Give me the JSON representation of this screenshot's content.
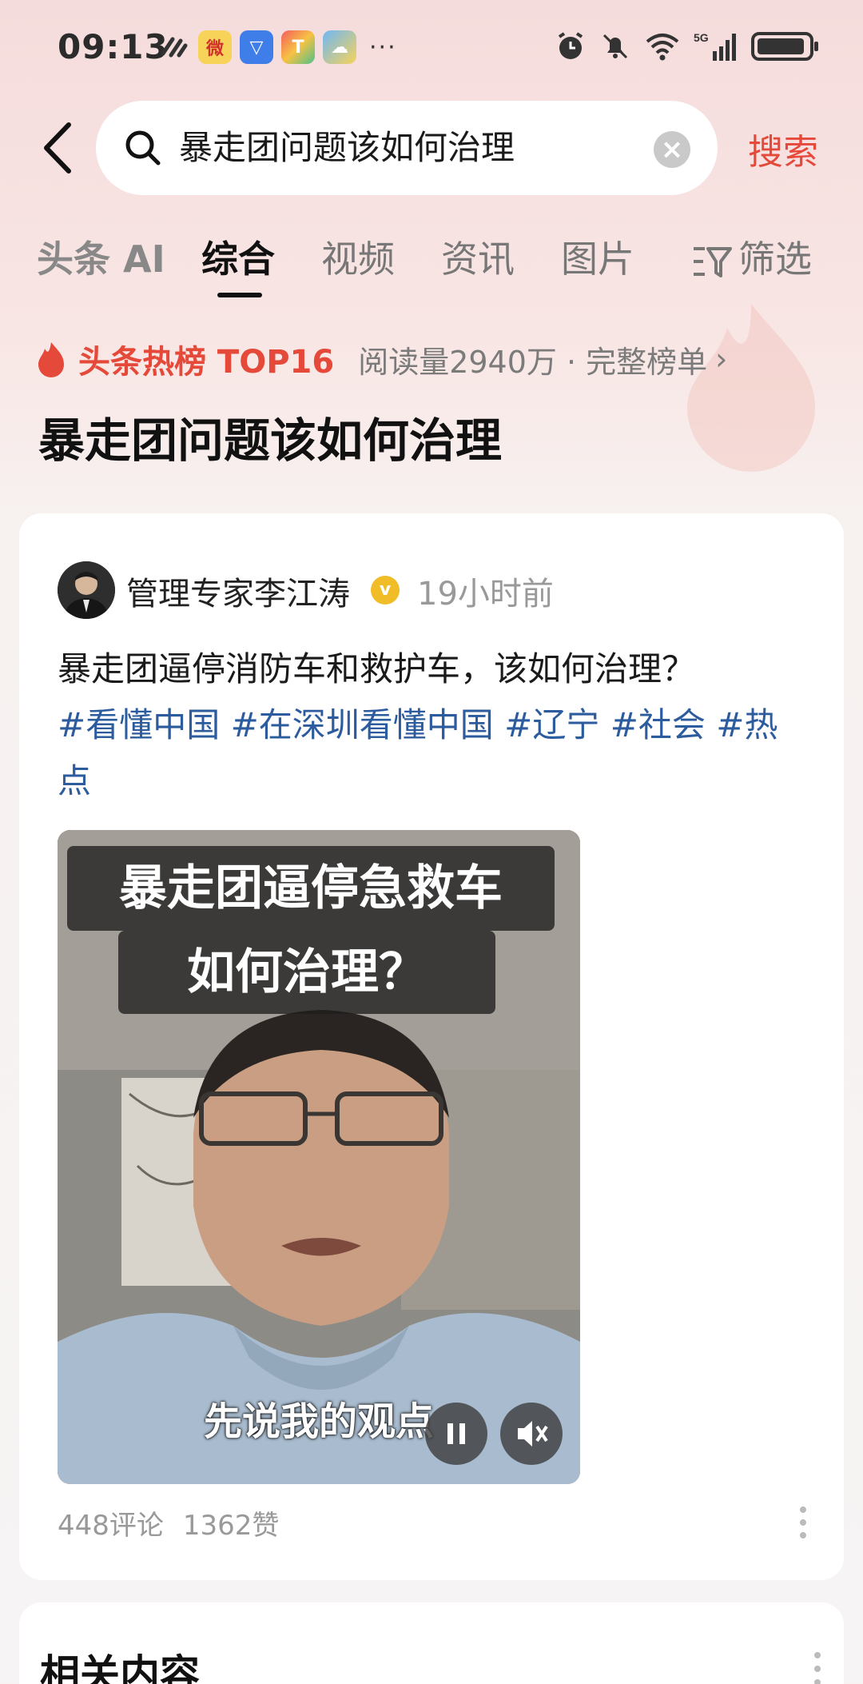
{
  "status_bar": {
    "time": "09:13",
    "more": "···",
    "network": "5G"
  },
  "search": {
    "query": "暴走团问题该如何治理",
    "submit_label": "搜索"
  },
  "tabs": [
    {
      "label": "头条 AI"
    },
    {
      "label": "综合"
    },
    {
      "label": "视频"
    },
    {
      "label": "资讯"
    },
    {
      "label": "图片"
    },
    {
      "label": "筛选"
    }
  ],
  "hot_board": {
    "label": "头条热榜 TOP16",
    "meta": "阅读量2940万 · 完整榜单",
    "chevron": "›",
    "topic_title": "暴走团问题该如何治理"
  },
  "post": {
    "author": "管理专家李江涛",
    "verified_mark": "v",
    "time": "19小时前",
    "text": "暴走团逼停消防车和救护车，该如何治理？",
    "tags": [
      "#看懂中国",
      "#在深圳看懂中国",
      "#辽宁",
      "#社会",
      "#热点"
    ],
    "video": {
      "caption_line1": "暴走团逼停急救车",
      "caption_line2": "如何治理？",
      "subtitle": "先说我的观点"
    },
    "comments": "448评论",
    "likes": "1362赞"
  },
  "related": {
    "title": "相关内容"
  },
  "colors": {
    "accent": "#e5493a",
    "tag": "#2d5c9e",
    "verified": "#f0bd28"
  }
}
